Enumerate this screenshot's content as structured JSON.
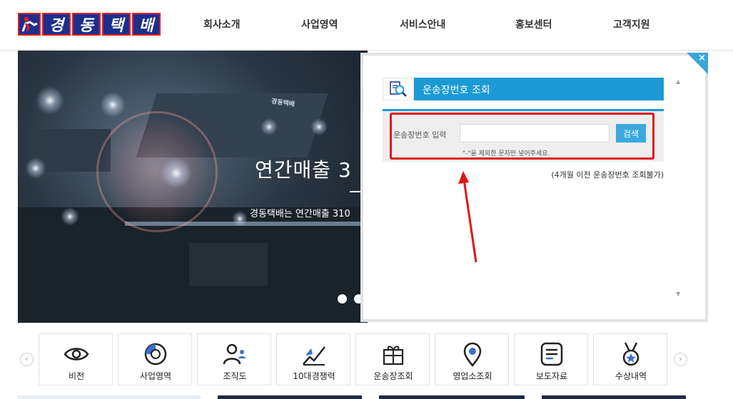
{
  "logo": {
    "text_chars": [
      "경",
      "동",
      "택",
      "배"
    ]
  },
  "nav": {
    "items": [
      "회사소개",
      "사업영역",
      "서비스안내",
      "홍보센터",
      "고객지원"
    ]
  },
  "hero": {
    "title": "연간매출 3",
    "subtitle": "경동택배는 연간매출 310",
    "sign": "경동택배"
  },
  "tracking": {
    "title": "운송장번호 조회",
    "input_label": "운송장번호 입력",
    "input_value": "",
    "input_placeholder": "",
    "search_button": "검색",
    "hint": "\"-\"을 제외한 문자만 넣어주세요.",
    "note": "(4개월 이전 운송장번호 조회불가)",
    "close_glyph": "×"
  },
  "quick_menu": {
    "items": [
      {
        "label": "비전",
        "icon": "eye-icon"
      },
      {
        "label": "사업영역",
        "icon": "pie-chart-icon"
      },
      {
        "label": "조직도",
        "icon": "people-icon"
      },
      {
        "label": "10대경쟁력",
        "icon": "growth-chart-icon"
      },
      {
        "label": "운송장조회",
        "icon": "gift-box-icon"
      },
      {
        "label": "영업소조회",
        "icon": "map-pin-icon"
      },
      {
        "label": "보도자료",
        "icon": "document-icon"
      },
      {
        "label": "수상내역",
        "icon": "medal-icon"
      }
    ],
    "prev_glyph": "‹",
    "next_glyph": "›"
  },
  "colors": {
    "brand_navy": "#1b2f8c",
    "brand_red": "#e21d24",
    "accent_blue": "#1b9ad6",
    "button_blue": "#3aa9dd",
    "annotation_red": "#e01515"
  }
}
